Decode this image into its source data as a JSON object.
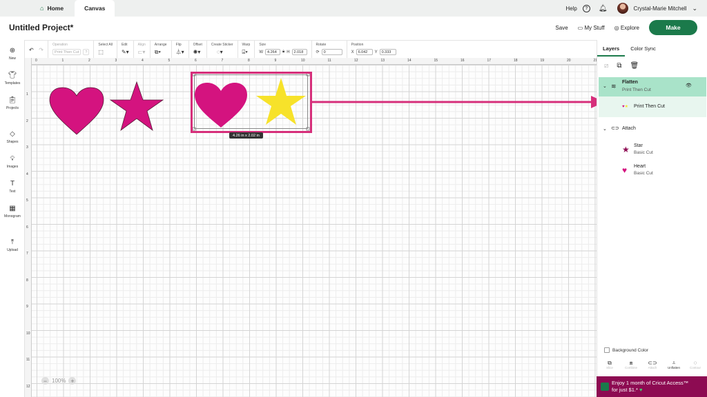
{
  "tabs": {
    "home": "Home",
    "canvas": "Canvas"
  },
  "topbar": {
    "help": "Help",
    "user": "Crystal-Marie Mitchell"
  },
  "header": {
    "title": "Untitled Project*",
    "save": "Save",
    "my_stuff": "My Stuff",
    "explore": "Explore",
    "make": "Make"
  },
  "toolbar": {
    "operation": "Operation",
    "operation_value": "Print Then Cut",
    "select_all": "Select All",
    "edit": "Edit",
    "align": "Align",
    "arrange": "Arrange",
    "flip": "Flip",
    "offset": "Offset",
    "create_sticker": "Create Sticker",
    "warp": "Warp",
    "size": "Size",
    "w_label": "W",
    "w_value": "4.264",
    "h_label": "H",
    "h_value": "2.018",
    "rotate": "Rotate",
    "rotate_value": "0",
    "position": "Position",
    "x_label": "X",
    "x_value": "6.042",
    "y_label": "Y",
    "y_value": "0.333"
  },
  "sidebar": {
    "items": [
      {
        "label": "New",
        "icon": "plus-circle-icon"
      },
      {
        "label": "Templates",
        "icon": "shirt-icon"
      },
      {
        "label": "Projects",
        "icon": "clipboard-icon"
      },
      {
        "label": "Shapes",
        "icon": "shapes-icon"
      },
      {
        "label": "Images",
        "icon": "lightbulb-icon"
      },
      {
        "label": "Text",
        "icon": "text-icon"
      },
      {
        "label": "Monogram",
        "icon": "monogram-icon"
      },
      {
        "label": "Upload",
        "icon": "upload-icon"
      }
    ]
  },
  "canvas": {
    "ruler_top": [
      "0",
      "1",
      "2",
      "3",
      "4",
      "5",
      "6",
      "7",
      "8",
      "9",
      "10",
      "11",
      "12",
      "13",
      "14",
      "15",
      "16",
      "17",
      "18",
      "19",
      "20",
      "21"
    ],
    "ruler_left": [
      "1",
      "2",
      "3",
      "4",
      "5",
      "6",
      "7",
      "8",
      "9",
      "10",
      "11",
      "12"
    ],
    "selection_size": "4.26  in x 2.02  in",
    "zoom": "100%",
    "colors": {
      "pink": "#d4137f",
      "yellow": "#f7e22a",
      "annotation": "#d62e7a"
    }
  },
  "panel": {
    "tab_layers": "Layers",
    "tab_color_sync": "Color Sync",
    "flatten": {
      "name": "Flatten",
      "sub": "Print Then Cut"
    },
    "flatten_child": "Print Then Cut",
    "attach": "Attach",
    "star": {
      "name": "Star",
      "sub": "Basic Cut"
    },
    "heart": {
      "name": "Heart",
      "sub": "Basic Cut"
    },
    "background_color": "Background Color",
    "bottom_tools": [
      "Slice",
      "Combine",
      "Attach",
      "Unflatten",
      "Contour"
    ]
  },
  "promo": {
    "line1": "Enjoy 1 month of Cricut Access™",
    "line2": "for just $1.*"
  }
}
